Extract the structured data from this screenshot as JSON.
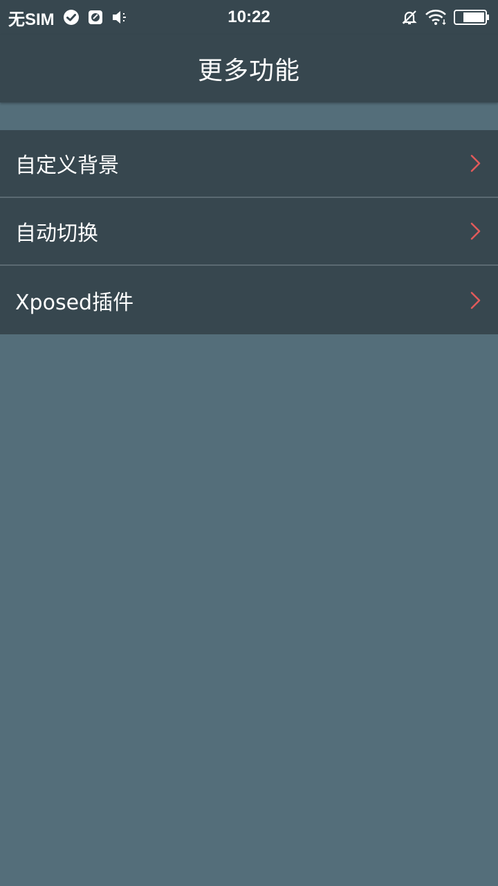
{
  "status_bar": {
    "carrier": "无SIM",
    "time": "10:22",
    "icons_left": [
      "check-circle-icon",
      "app-badge-icon",
      "speaker-icon"
    ],
    "icons_right": [
      "bell-muted-icon",
      "wifi-icon",
      "battery-icon"
    ]
  },
  "header": {
    "title": "更多功能"
  },
  "menu": {
    "items": [
      {
        "label": "自定义背景"
      },
      {
        "label": "自动切换"
      },
      {
        "label": "Xposed插件"
      }
    ]
  },
  "colors": {
    "bar": "#37474f",
    "background": "#546e7a",
    "chevron": "#e05a5a",
    "divider": "#5b6a72"
  }
}
